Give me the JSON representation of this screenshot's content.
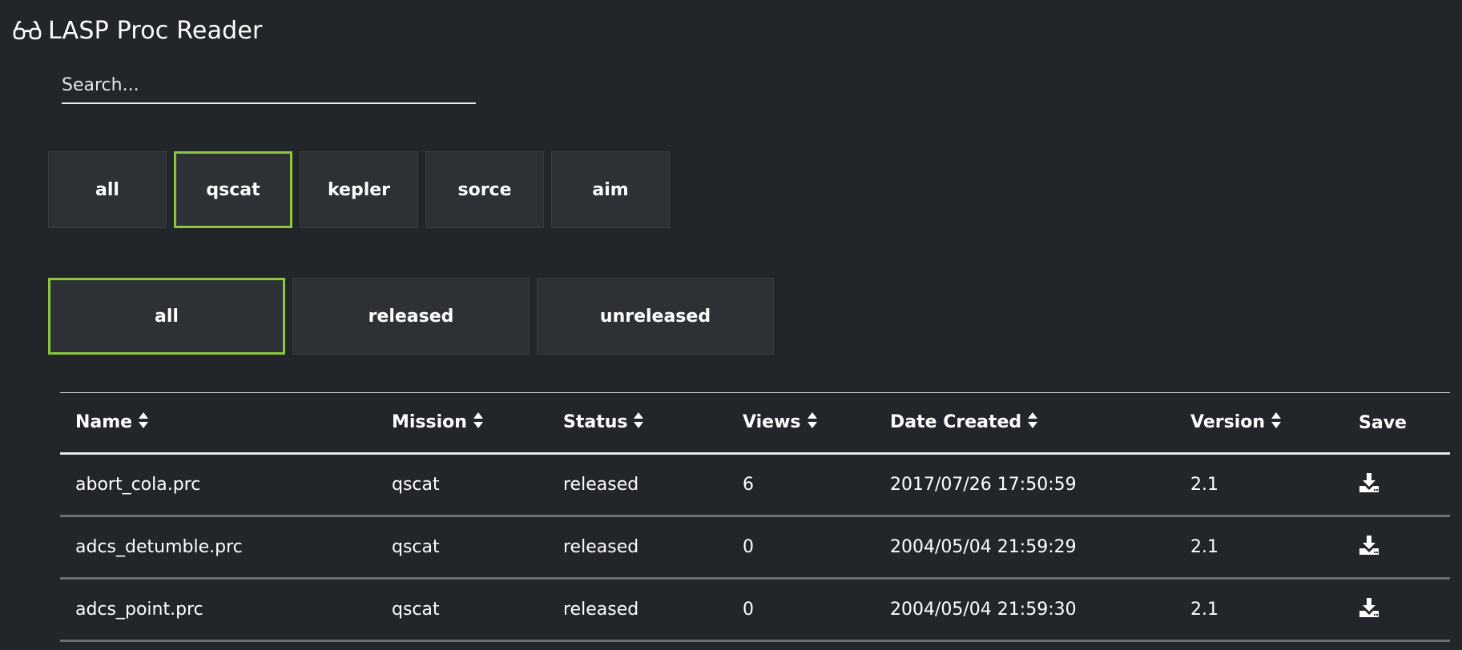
{
  "app": {
    "title": "LASP Proc Reader",
    "logo_icon": "glasses-icon"
  },
  "search": {
    "placeholder": "Search..."
  },
  "mission_filters": [
    {
      "label": "all",
      "active": false
    },
    {
      "label": "qscat",
      "active": true
    },
    {
      "label": "kepler",
      "active": false
    },
    {
      "label": "sorce",
      "active": false
    },
    {
      "label": "aim",
      "active": false
    }
  ],
  "status_filters": [
    {
      "label": "all",
      "active": true
    },
    {
      "label": "released",
      "active": false
    },
    {
      "label": "unreleased",
      "active": false
    }
  ],
  "table": {
    "columns": [
      "Name",
      "Mission",
      "Status",
      "Views",
      "Date Created",
      "Version",
      "Save"
    ],
    "rows": [
      {
        "name": "abort_cola.prc",
        "mission": "qscat",
        "status": "released",
        "views": "6",
        "date_created": "2017/07/26 17:50:59",
        "version": "2.1"
      },
      {
        "name": "adcs_detumble.prc",
        "mission": "qscat",
        "status": "released",
        "views": "0",
        "date_created": "2004/05/04 21:59:29",
        "version": "2.1"
      },
      {
        "name": "adcs_point.prc",
        "mission": "qscat",
        "status": "released",
        "views": "0",
        "date_created": "2004/05/04 21:59:30",
        "version": "2.1"
      }
    ]
  },
  "colors": {
    "background": "#222529",
    "button_bg": "#2d3135",
    "active_accent": "#8cc63f",
    "text": "#ffffff"
  }
}
